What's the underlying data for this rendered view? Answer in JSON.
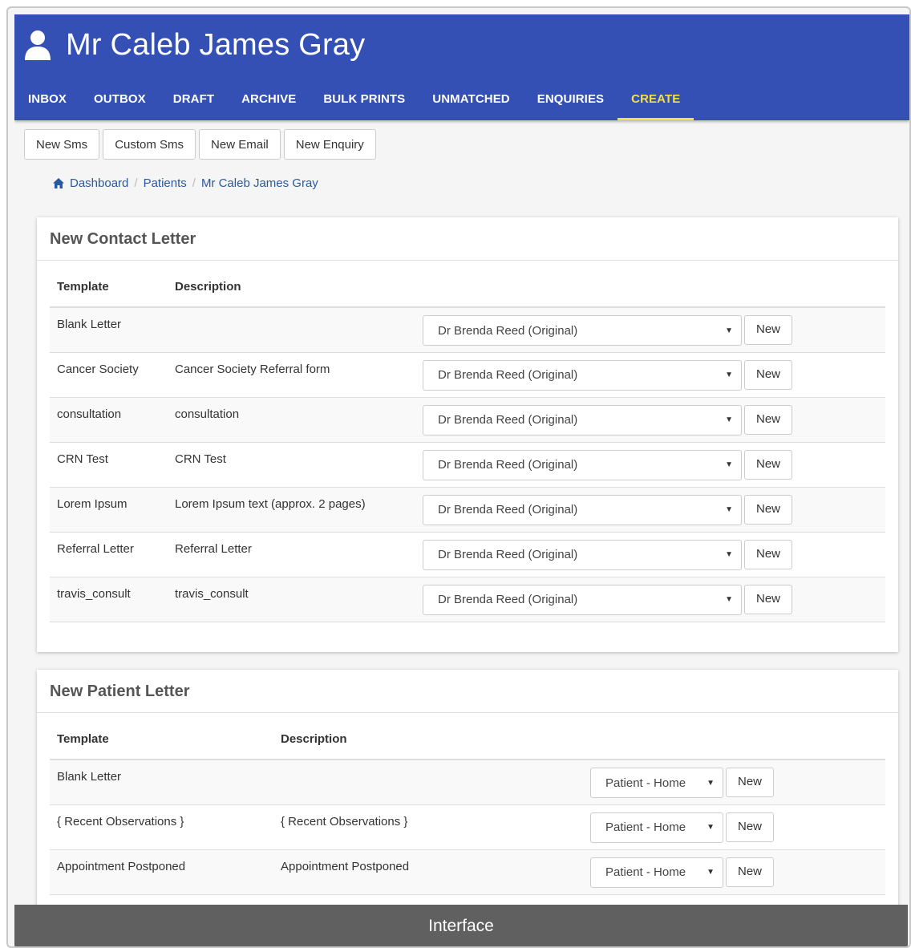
{
  "header": {
    "title": "Mr Caleb James Gray",
    "icon": "user-icon",
    "bg_color": "#3450b4",
    "active_color": "#f5e03c"
  },
  "nav": [
    {
      "label": "INBOX",
      "active": false
    },
    {
      "label": "OUTBOX",
      "active": false
    },
    {
      "label": "DRAFT",
      "active": false
    },
    {
      "label": "ARCHIVE",
      "active": false
    },
    {
      "label": "BULK PRINTS",
      "active": false
    },
    {
      "label": "UNMATCHED",
      "active": false
    },
    {
      "label": "ENQUIRIES",
      "active": false
    },
    {
      "label": "CREATE",
      "active": true
    }
  ],
  "actions": [
    "New Sms",
    "Custom Sms",
    "New Email",
    "New Enquiry"
  ],
  "breadcrumb": [
    "Dashboard",
    "Patients",
    "Mr Caleb James Gray"
  ],
  "contact_letter": {
    "title": "New Contact Letter",
    "headers": {
      "template": "Template",
      "description": "Description"
    },
    "new_label": "New",
    "rows": [
      {
        "template": "Blank Letter",
        "description": "",
        "author": "Dr Brenda Reed (Original)"
      },
      {
        "template": "Cancer Society",
        "description": "Cancer Society Referral form",
        "author": "Dr Brenda Reed (Original)"
      },
      {
        "template": "consultation",
        "description": "consultation",
        "author": "Dr Brenda Reed (Original)"
      },
      {
        "template": "CRN Test",
        "description": "CRN Test",
        "author": "Dr Brenda Reed (Original)"
      },
      {
        "template": "Lorem Ipsum",
        "description": "Lorem Ipsum text (approx. 2 pages)",
        "author": "Dr Brenda Reed (Original)"
      },
      {
        "template": "Referral Letter",
        "description": "Referral Letter",
        "author": "Dr Brenda Reed (Original)"
      },
      {
        "template": "travis_consult",
        "description": "travis_consult",
        "author": "Dr Brenda Reed (Original)"
      }
    ]
  },
  "patient_letter": {
    "title": "New Patient Letter",
    "headers": {
      "template": "Template",
      "description": "Description"
    },
    "new_label": "New",
    "rows": [
      {
        "template": "Blank Letter",
        "description": "",
        "address": "Patient - Home"
      },
      {
        "template": "{ Recent Observations }",
        "description": "{ Recent Observations }",
        "address": "Patient - Home"
      },
      {
        "template": "Appointment Postponed",
        "description": "Appointment Postponed",
        "address": "Patient - Home"
      }
    ]
  },
  "footer_label": "Interface"
}
